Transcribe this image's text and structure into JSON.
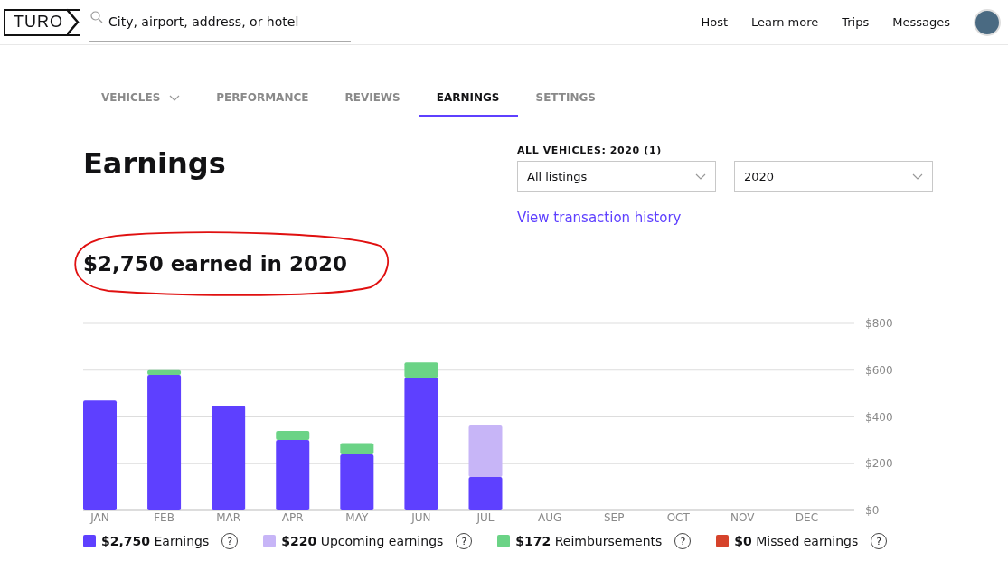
{
  "header": {
    "logo": "TURO",
    "search": {
      "placeholder": "City, airport, address, or hotel"
    },
    "nav": [
      "Host",
      "Learn more",
      "Trips",
      "Messages"
    ]
  },
  "tabs": [
    {
      "label": "VEHICLES",
      "selected": false,
      "dropdown": true
    },
    {
      "label": "PERFORMANCE",
      "selected": false,
      "dropdown": false
    },
    {
      "label": "REVIEWS",
      "selected": false,
      "dropdown": false
    },
    {
      "label": "EARNINGS",
      "selected": true,
      "dropdown": false
    },
    {
      "label": "SETTINGS",
      "selected": false,
      "dropdown": false
    }
  ],
  "title": "Earnings",
  "filters": {
    "label": "ALL VEHICLES: 2020 (1)",
    "listing": "All listings",
    "year": "2020",
    "link": "View transaction history"
  },
  "headline": "$2,750 earned in 2020",
  "chart_data": {
    "type": "bar",
    "stacked": true,
    "grid": true,
    "categories": [
      "JAN",
      "FEB",
      "MAR",
      "APR",
      "MAY",
      "JUN",
      "JUL",
      "AUG",
      "SEP",
      "OCT",
      "NOV",
      "DEC"
    ],
    "yticks": [
      {
        "value": 0,
        "label": "$0"
      },
      {
        "value": 200,
        "label": "$200"
      },
      {
        "value": 400,
        "label": "$400"
      },
      {
        "value": 600,
        "label": "$600"
      },
      {
        "value": 800,
        "label": "$800"
      }
    ],
    "ylim": [
      0,
      800
    ],
    "series": [
      {
        "name": "Earnings",
        "color": "#5e40ff",
        "values": [
          471,
          580,
          448,
          301,
          240,
          568,
          143,
          0,
          0,
          0,
          0,
          0
        ]
      },
      {
        "name": "Upcoming earnings",
        "color": "#c7b5f7",
        "values": [
          0,
          0,
          0,
          0,
          0,
          0,
          220,
          0,
          0,
          0,
          0,
          0
        ]
      },
      {
        "name": "Reimbursements",
        "color": "#6bd386",
        "values": [
          0,
          20,
          0,
          39,
          48,
          65,
          0,
          0,
          0,
          0,
          0,
          0
        ]
      },
      {
        "name": "Missed earnings",
        "color": "#d6432b",
        "values": [
          0,
          0,
          0,
          0,
          0,
          0,
          0,
          0,
          0,
          0,
          0,
          0
        ]
      }
    ]
  },
  "legend": [
    {
      "amount": "$2,750",
      "help": "?"
    },
    {
      "amount": "$220",
      "help": "?"
    },
    {
      "amount": "$172",
      "help": "?"
    },
    {
      "amount": "$0",
      "help": "?"
    }
  ]
}
